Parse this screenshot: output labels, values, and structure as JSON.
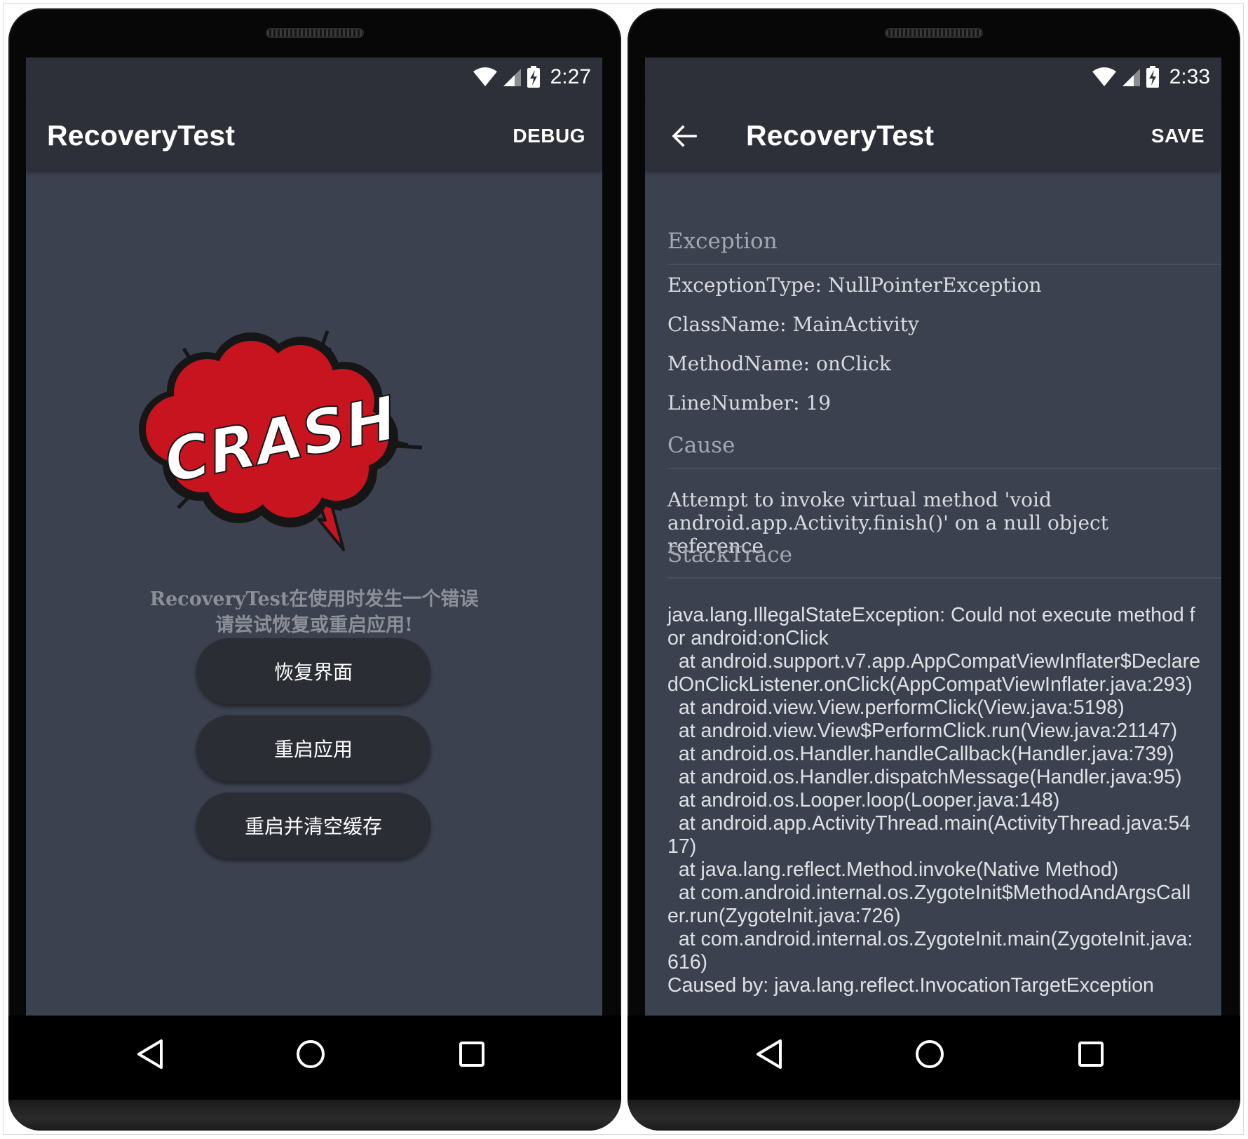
{
  "left_phone": {
    "status": {
      "time": "2:27"
    },
    "appbar": {
      "title": "RecoveryTest",
      "action": "DEBUG"
    },
    "crash_logo_text": "CRASH",
    "message": {
      "line1": "RecoveryTest在使用时发生一个错误",
      "line2": "请尝试恢复或重启应用!"
    },
    "buttons": {
      "recover": "恢复界面",
      "restart": "重启应用",
      "restart_clear": "重启并清空缓存"
    }
  },
  "right_phone": {
    "status": {
      "time": "2:33"
    },
    "appbar": {
      "title": "RecoveryTest",
      "action": "SAVE"
    },
    "exception": {
      "title": "Exception",
      "type": "ExceptionType: NullPointerException",
      "class": "ClassName: MainActivity",
      "method": "MethodName: onClick",
      "line": "LineNumber: 19"
    },
    "cause": {
      "title": "Cause",
      "text": "Attempt to invoke virtual method 'void android.app.Activity.finish()' on a null object reference"
    },
    "stacktrace": {
      "title": "StackTrace",
      "text": "java.lang.IllegalStateException: Could not execute method for android:onClick\n  at android.support.v7.app.AppCompatViewInflater$DeclaredOnClickListener.onClick(AppCompatViewInflater.java:293)\n  at android.view.View.performClick(View.java:5198)\n  at android.view.View$PerformClick.run(View.java:21147)\n  at android.os.Handler.handleCallback(Handler.java:739)\n  at android.os.Handler.dispatchMessage(Handler.java:95)\n  at android.os.Looper.loop(Looper.java:148)\n  at android.app.ActivityThread.main(ActivityThread.java:5417)\n  at java.lang.reflect.Method.invoke(Native Method)\n  at com.android.internal.os.ZygoteInit$MethodAndArgsCaller.run(ZygoteInit.java:726)\n  at com.android.internal.os.ZygoteInit.main(ZygoteInit.java:616)\nCaused by: java.lang.reflect.InvocationTargetException"
    }
  },
  "icons": {
    "status": [
      "wifi-icon",
      "cell-signal-icon",
      "battery-charging-icon"
    ],
    "nav": [
      "back-triangle-icon",
      "home-circle-icon",
      "recents-square-icon"
    ],
    "appbar_back": "arrow-back-icon"
  },
  "colors": {
    "screen_bg": "#3c4150",
    "appbar_bg": "#2e3039",
    "button_bg": "#2b2d35",
    "crash_red": "#c8141f",
    "message_text": "#8c8f97"
  }
}
